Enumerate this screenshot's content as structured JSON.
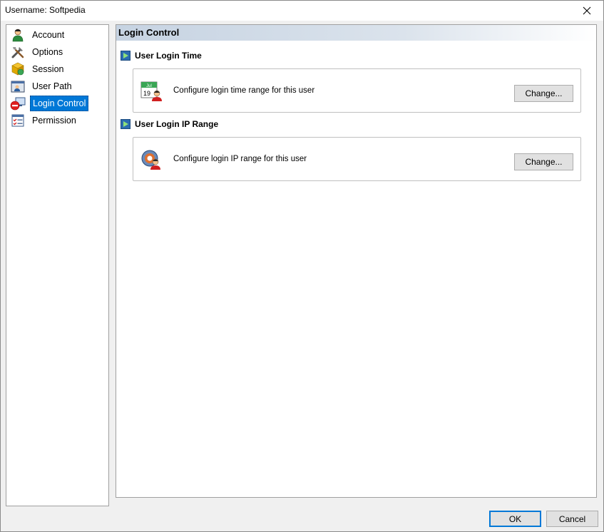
{
  "window": {
    "title": "Username: Softpedia"
  },
  "sidebar": {
    "items": [
      {
        "label": "Account",
        "icon": "account-icon"
      },
      {
        "label": "Options",
        "icon": "tools-icon"
      },
      {
        "label": "Session",
        "icon": "session-icon"
      },
      {
        "label": "User Path",
        "icon": "folder-user-icon"
      },
      {
        "label": "Login Control",
        "icon": "login-control-icon",
        "selected": true
      },
      {
        "label": "Permission",
        "icon": "permission-icon"
      }
    ]
  },
  "main": {
    "header": "Login Control",
    "sections": [
      {
        "title": "User Login Time",
        "description": "Configure login time range for this user",
        "button": "Change...",
        "icon": "calendar-user-icon",
        "calendar_month": "Jul",
        "calendar_day": "19"
      },
      {
        "title": "User Login IP Range",
        "description": "Configure login IP range for this user",
        "button": "Change...",
        "icon": "ip-user-icon"
      }
    ]
  },
  "footer": {
    "ok_label": "OK",
    "cancel_label": "Cancel"
  },
  "colors": {
    "selection": "#0078d7",
    "header_gradient_start": "#c6d3e2"
  }
}
